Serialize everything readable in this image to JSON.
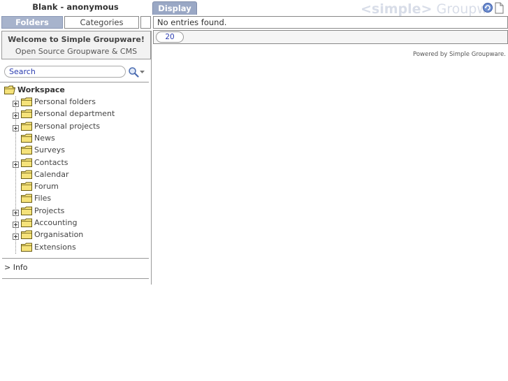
{
  "header": {
    "app_title": "Blank - anonymous",
    "brand_tag": "<simple>",
    "brand_name": "Groupware",
    "display_tab": "Display"
  },
  "sidebar": {
    "tabs": [
      {
        "label": "Folders",
        "active": true
      },
      {
        "label": "Categories",
        "active": false
      }
    ],
    "welcome": {
      "title": "Welcome to Simple Groupware!",
      "subtitle": "Open Source Groupware & CMS"
    },
    "search": {
      "value": "Search"
    },
    "tree": {
      "root": "Workspace",
      "items": [
        {
          "label": "Personal folders",
          "expandable": true
        },
        {
          "label": "Personal department",
          "expandable": true
        },
        {
          "label": "Personal projects",
          "expandable": true
        },
        {
          "label": "News",
          "expandable": false
        },
        {
          "label": "Surveys",
          "expandable": false
        },
        {
          "label": "Contacts",
          "expandable": true
        },
        {
          "label": "Calendar",
          "expandable": false
        },
        {
          "label": "Forum",
          "expandable": false
        },
        {
          "label": "Files",
          "expandable": false
        },
        {
          "label": "Projects",
          "expandable": true
        },
        {
          "label": "Accounting",
          "expandable": true
        },
        {
          "label": "Organisation",
          "expandable": true
        },
        {
          "label": "Extensions",
          "expandable": false
        }
      ]
    },
    "info_link": "> Info"
  },
  "main": {
    "status": "No entries found.",
    "page_size": "20",
    "powered_by": "Powered by Simple Groupware."
  },
  "colors": {
    "accent": "#9aa8c5",
    "link": "#2b3cb0",
    "folder": "#f5e27a"
  }
}
